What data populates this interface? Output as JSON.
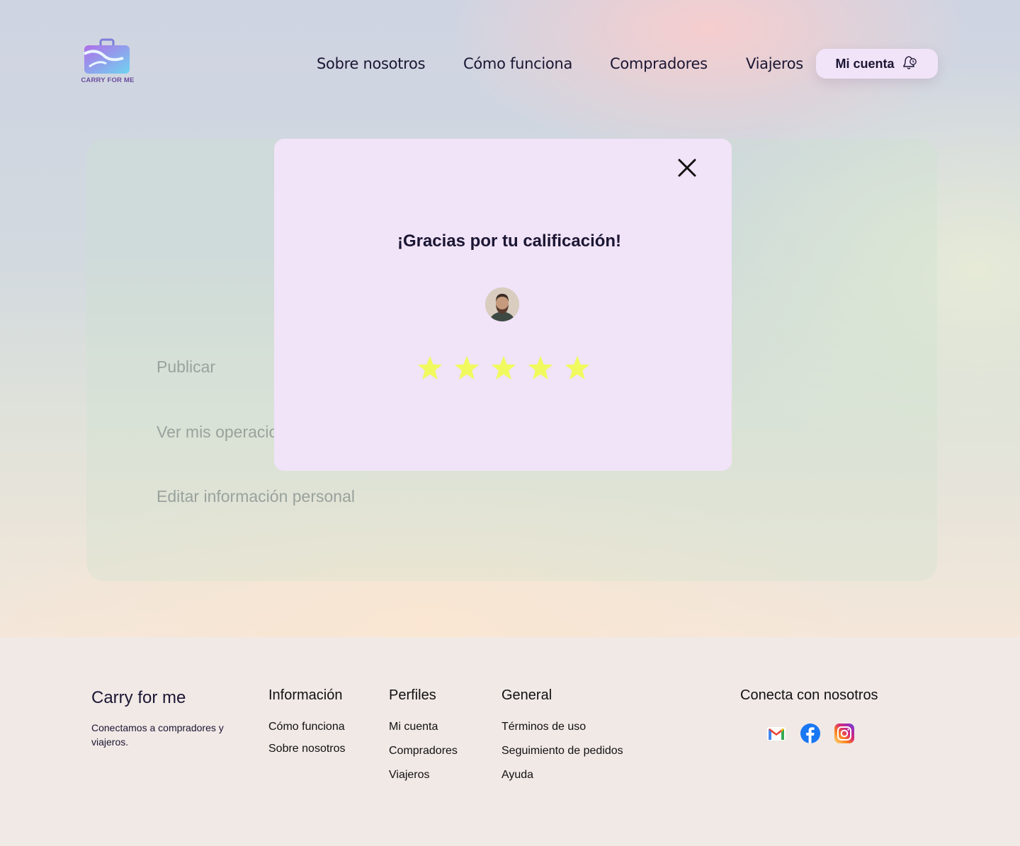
{
  "brand": {
    "logo_text": "CARRY FOR ME"
  },
  "nav": {
    "items": [
      "Sobre nosotros",
      "Cómo funciona",
      "Compradores",
      "Viajeros"
    ],
    "account_label": "Mi cuenta",
    "account_icon": "bell-clock-icon"
  },
  "panel": {
    "menu": [
      "Publicar",
      "Ver mis operaciones",
      "Editar información personal"
    ]
  },
  "modal": {
    "title": "¡Gracias por tu calificación!",
    "close_icon": "close-icon",
    "rating": 5,
    "rating_max": 5,
    "star_color": "#f0fa5f"
  },
  "footer": {
    "brand": "Carry for me",
    "tagline": "Conectamos a compradores y viajeros.",
    "columns": [
      {
        "title": "Información",
        "links": [
          "Cómo funciona",
          "Sobre nosotros"
        ]
      },
      {
        "title": "Perfiles",
        "links": [
          "Mi cuenta",
          "Compradores",
          "Viajeros"
        ]
      },
      {
        "title": "General",
        "links": [
          "Términos de uso",
          "Seguimiento de pedidos",
          "Ayuda"
        ]
      }
    ],
    "social_title": "Conecta con nosotros",
    "social_icons": [
      "gmail-icon",
      "facebook-icon",
      "instagram-icon"
    ]
  },
  "colors": {
    "modal_bg": "#f1e3f8",
    "account_bg": "#f1e3f8",
    "text_dark": "#1b1633",
    "menu_muted": "#9aa29d"
  }
}
